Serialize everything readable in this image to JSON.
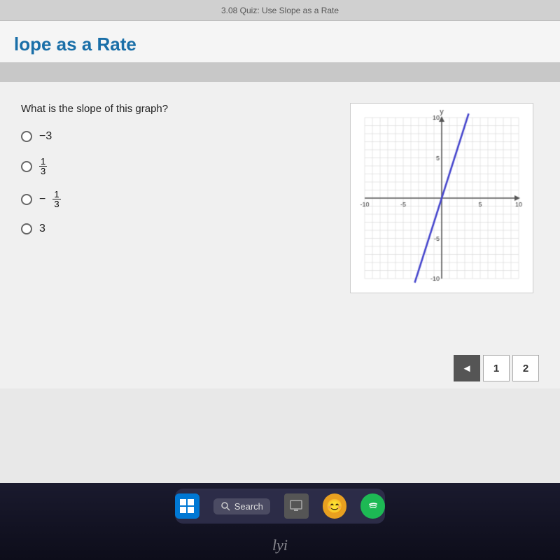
{
  "header": {
    "browser_title": "3.08 Quiz: Use Slope as a Rate"
  },
  "page": {
    "title": "lope as a Rate",
    "full_title": "Use Slope as a Rate"
  },
  "quiz": {
    "question": "What is the slope of this graph?",
    "options": [
      {
        "id": "a",
        "label": "−3",
        "type": "text"
      },
      {
        "id": "b",
        "label": "1/3",
        "type": "fraction",
        "numerator": "1",
        "denominator": "3"
      },
      {
        "id": "c",
        "label": "−1/3",
        "type": "fraction-neg",
        "numerator": "1",
        "denominator": "3"
      },
      {
        "id": "d",
        "label": "3",
        "type": "text"
      }
    ]
  },
  "navigation": {
    "prev_label": "◄",
    "page1_label": "1",
    "page2_label": "2"
  },
  "taskbar": {
    "search_placeholder": "Search",
    "handwriting": "lyi"
  },
  "graph": {
    "x_min": -10,
    "x_max": 10,
    "y_min": -10,
    "y_max": 10,
    "line_color": "#4444cc",
    "grid_color": "#ccc",
    "axis_color": "#555",
    "slope": 3,
    "intercept": 0
  }
}
